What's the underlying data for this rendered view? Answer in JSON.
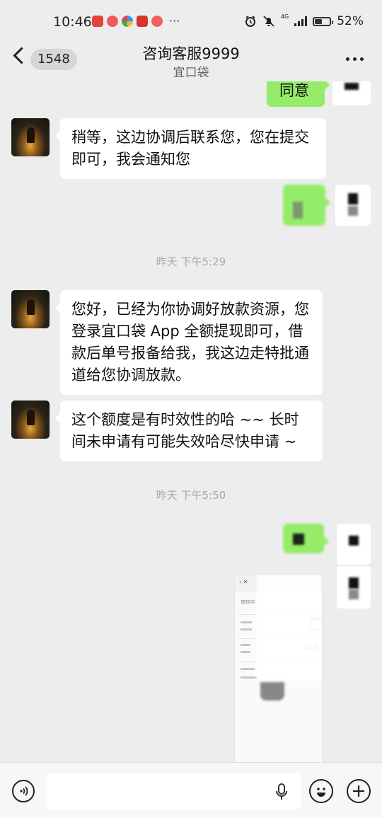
{
  "status_bar": {
    "time": "10:46",
    "more": "···",
    "network": "4G",
    "battery": "52%",
    "battery_level": 0.52,
    "signal_bars": 4,
    "app_icons": [
      "huawei-app-icon",
      "app-icon-red",
      "app-icon-multicolor",
      "app-icon-game",
      "app-icon-red"
    ]
  },
  "nav": {
    "unread_count": "1548",
    "title": "咨询客服9999",
    "subtitle": "宜口袋"
  },
  "messages": {
    "top_out_partial": "同意",
    "msg1": "稍等，这边协调后联系您，您在提交即可，我会通知您",
    "time1": "昨天 下午5:29",
    "msg2": "您好，已经为你协调好放款资源，您登录宜口袋 App 全额提现即可，借款后单号报备给我，我这边走特批通道给您协调放款。",
    "msg3": "这个额度是有时效性的哈 ~~ 长时间未申请有可能失效哈尽快申请 ~",
    "time2": "昨天 下午5:50"
  },
  "screenshot_preview": {
    "status_text": "审核中",
    "amount": "1100",
    "code": "00521"
  },
  "colors": {
    "background": "#ededed",
    "bubble_out": "#95ec69",
    "bubble_in": "#ffffff",
    "timestamp": "#a8a8a8"
  },
  "input_bar": {
    "voice_icon": "voice-mode-icon",
    "mic_icon": "mic-icon",
    "emoji_icon": "emoji-icon",
    "add_icon": "add-icon"
  }
}
